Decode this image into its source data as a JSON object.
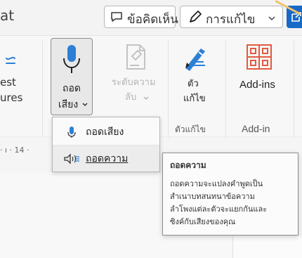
{
  "topbar": {
    "left_text": "at",
    "comment_label": "ข้อคิดเห็น",
    "edit_label": "การแก้ไข",
    "accent_color": "#1769C7"
  },
  "ribbon": {
    "left_top": "est",
    "left_bottom": "ures",
    "dictate_top": "ถอด",
    "dictate_bottom": "เสียง",
    "sensitivity_top": "ระดับความ",
    "sensitivity_bottom": "ลับ",
    "editor_top": "ตัว",
    "editor_bottom": "แก้ไข",
    "addins_label": "Add-ins",
    "editor_group_label": "ตัวแก้ไข",
    "addin_group_label": "Add-in"
  },
  "menu": {
    "items": [
      {
        "label": "ถอดเสียง",
        "icon": "microphone-icon"
      },
      {
        "label": "ถอดความ",
        "icon": "transcribe-icon"
      }
    ]
  },
  "ruler": {
    "text": "· ı · 14 ·"
  },
  "tooltip": {
    "title": "ถอดความ",
    "lines": [
      "ถอดความจะแปลงคำพูดเป็น",
      "สำเนาบทสนทนาข้อความ",
      "ลำโพงแต่ละตัวจะแยกกันและ",
      "ซิงค์กับเสียงของคุณ"
    ]
  }
}
